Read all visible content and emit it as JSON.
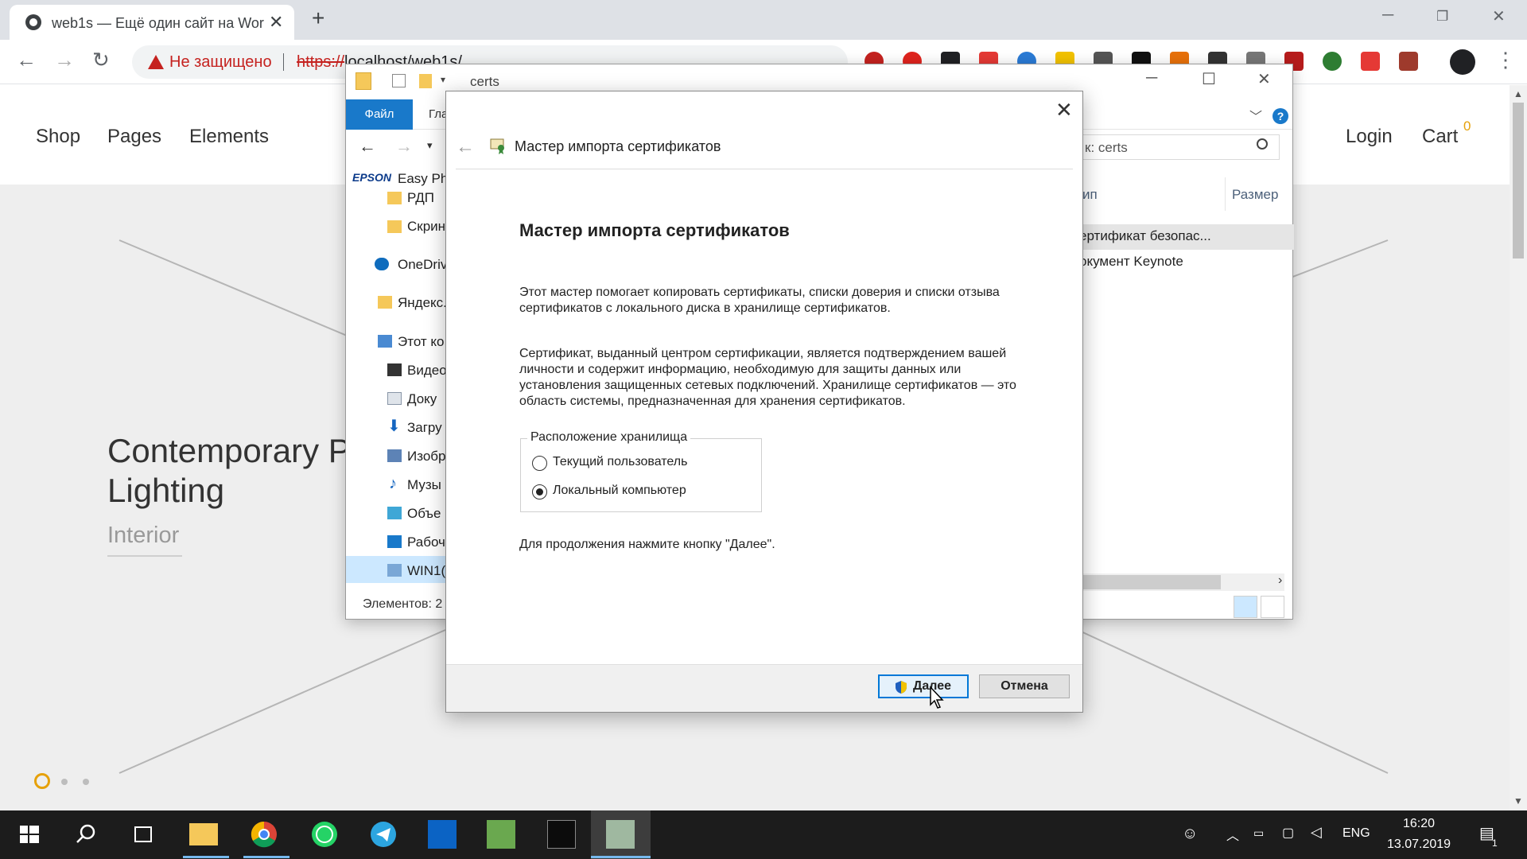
{
  "browser": {
    "tab_title": "web1s — Ещё один сайт на Wor",
    "security_label": "Не защищено",
    "url_scheme": "https://",
    "url_rest": "localhost/web1s/"
  },
  "site": {
    "nav": [
      "Shop",
      "Pages",
      "Elements"
    ],
    "login": "Login",
    "cart": "Cart",
    "cart_count": "0",
    "hero_title": "Contemporary P Lighting",
    "hero_subtitle": "Interior",
    "accent_color": "#e6a10a"
  },
  "explorer": {
    "title": "certs",
    "file_tab": "Файл",
    "ribbon_tab": "Гла",
    "search_value": "к: certs",
    "tree": [
      "Easy Ph",
      "РДП",
      "Скрин",
      "OneDriv",
      "Яндекс.",
      "Этот ко",
      "Видео",
      "Доку",
      "Загру",
      "Изобр",
      "Музы",
      "Объе",
      "Рабоч",
      "WIN1("
    ],
    "epson_label": "EPSON",
    "status": "Элементов: 2",
    "col_type": "ип",
    "col_size": "Размер",
    "rows": [
      "ертификат безопас...",
      "окумент Keynote"
    ]
  },
  "wizard": {
    "header_title": "Мастер импорта сертификатов",
    "heading": "Мастер импорта сертификатов",
    "para1": "Этот мастер помогает копировать сертификаты, списки доверия и списки отзыва сертификатов с локального диска в хранилище сертификатов.",
    "para2": "Сертификат, выданный центром сертификации, является подтверждением вашей личности и содержит информацию, необходимую для защиты данных или установления защищенных сетевых подключений. Хранилище сертификатов — это область системы, предназначенная для хранения сертификатов.",
    "group_label": "Расположение хранилища",
    "option_current_user": "Текущий пользователь",
    "option_local_machine": "Локальный компьютер",
    "selected_option": "Локальный компьютер",
    "continue_hint": "Для продолжения нажмите кнопку \"Далее\".",
    "next_button": "Далее",
    "cancel_button": "Отмена"
  },
  "taskbar": {
    "language": "ENG",
    "time": "16:20",
    "date": "13.07.2019",
    "notification_count": "1"
  }
}
